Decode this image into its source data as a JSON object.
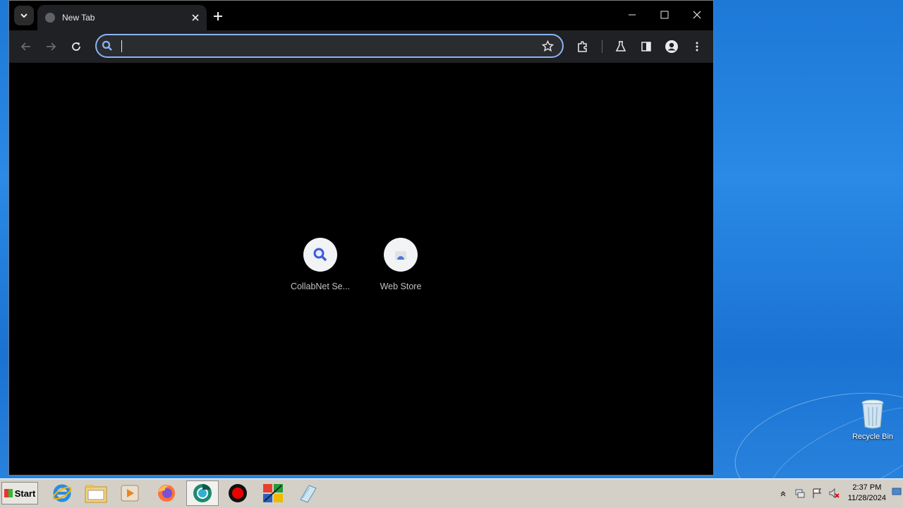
{
  "browser": {
    "tab_title": "New Tab",
    "omnibox_value": "",
    "shortcuts": [
      {
        "label": "CollabNet Se...",
        "icon": "search-icon"
      },
      {
        "label": "Web Store",
        "icon": "web-store-icon"
      }
    ]
  },
  "desktop": {
    "recycle_bin_label": "Recycle Bin"
  },
  "taskbar": {
    "start_label": "Start",
    "apps": [
      "internet-explorer-icon",
      "file-explorer-icon",
      "media-player-icon",
      "firefox-icon",
      "chrome-icon",
      "record-icon",
      "app-icon",
      "notepad-icon"
    ],
    "clock_time": "2:37 PM",
    "clock_date": "11/28/2024"
  },
  "colors": {
    "accent": "#8ab4f8",
    "window_bg": "#000000",
    "toolbar_bg": "#202124",
    "taskbar_bg": "#d4d0c8"
  }
}
